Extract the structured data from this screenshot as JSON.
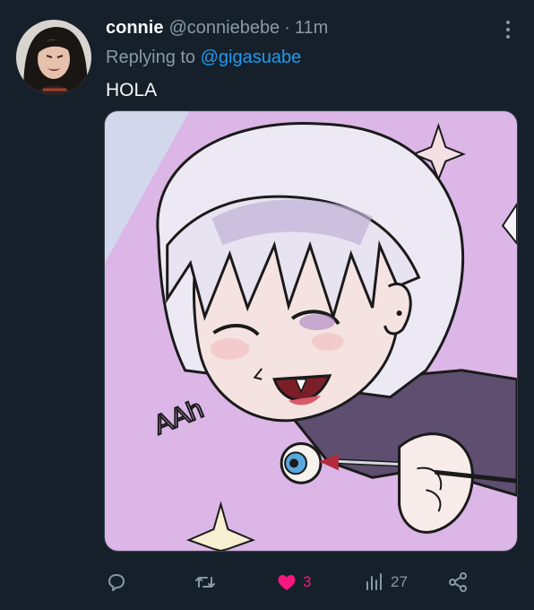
{
  "tweet": {
    "author": {
      "display_name": "connie",
      "handle": "@conniebebe"
    },
    "separator": "·",
    "timestamp": "11m",
    "reply": {
      "prefix": "Replying to ",
      "to_handle": "@gigasuabe"
    },
    "text": "HOLA",
    "media": {
      "drawn_text": "AAh"
    },
    "actions": {
      "reply_icon": "comment-icon",
      "retweet_icon": "retweet-icon",
      "like_icon": "heart-filled-icon",
      "like_count": "3",
      "views_icon": "bar-chart-icon",
      "view_count": "27",
      "share_icon": "share-icon"
    },
    "more_icon": "more-vertical-icon"
  },
  "colors": {
    "background": "#15202b",
    "primary_text": "#f7f9f9",
    "secondary_text": "#8b98a5",
    "link": "#1d9bf0",
    "like": "#f91880"
  }
}
